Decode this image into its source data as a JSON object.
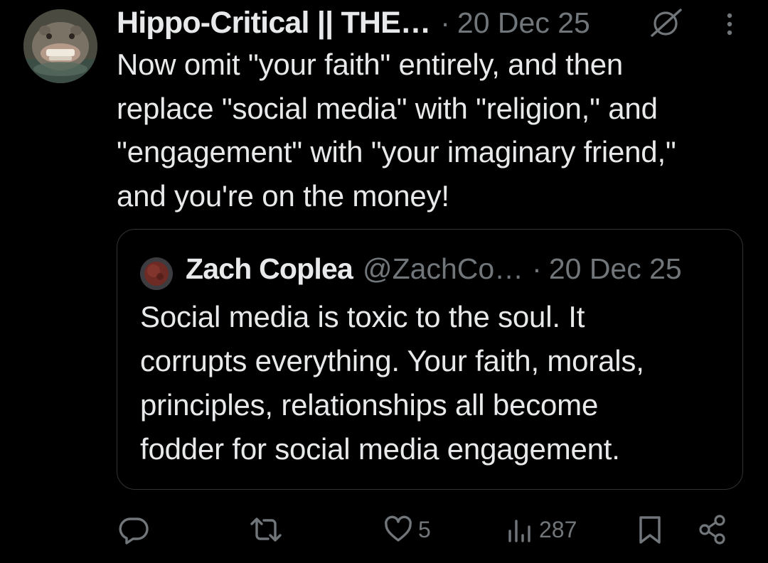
{
  "post": {
    "display_name": "Hippo-Critical || THE…",
    "separator": "·",
    "time": "20 Dec 25",
    "text_lines": [
      "Now omit \"your faith\" entirely, and then",
      "replace \"social media\" with \"religion,\" and",
      "\"engagement\" with \"your imaginary friend,\"",
      "and you're on the money!"
    ]
  },
  "quote": {
    "display_name": "Zach Coplea",
    "handle": "@ZachCo…",
    "separator": "·",
    "time": "20 Dec 25",
    "text_lines": [
      "Social media is toxic to the soul. It",
      "corrupts everything. Your faith, morals,",
      "principles, relationships all become",
      "fodder for social media engagement."
    ]
  },
  "actions": {
    "reply_icon": "reply-icon",
    "repost_icon": "repost-icon",
    "like_icon": "heart-icon",
    "like_count": "5",
    "views_icon": "views-icon",
    "views_count": "287",
    "bookmark_icon": "bookmark-icon",
    "share_icon": "share-icon"
  },
  "colors": {
    "background": "#000000",
    "text_primary": "#e7e9ea",
    "text_secondary": "#71767b",
    "border": "#2f3336"
  }
}
